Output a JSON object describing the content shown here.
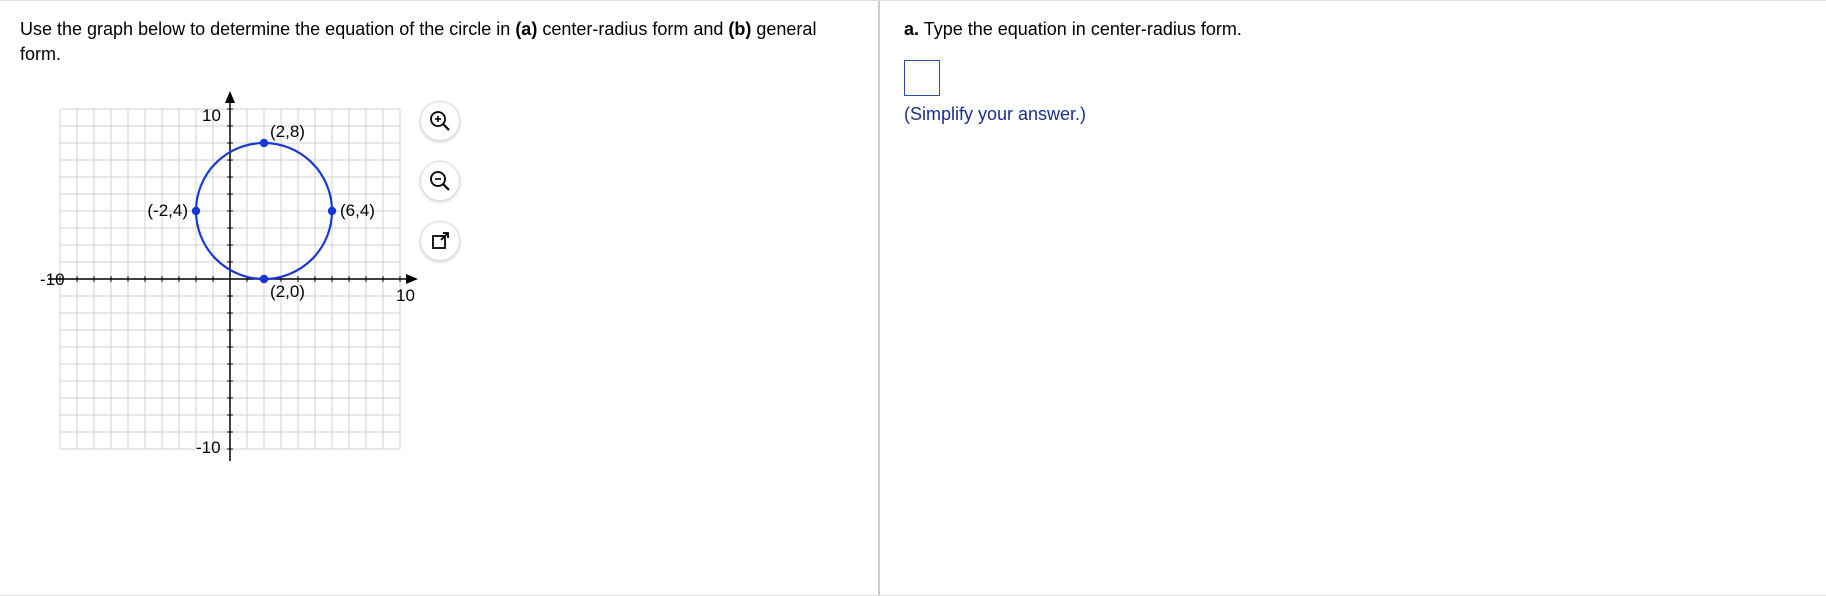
{
  "prompt": {
    "prefix": "Use the graph below to determine the equation of the circle in ",
    "part_a_label": "(a)",
    "middle": " center-radius form and ",
    "part_b_label": "(b)",
    "suffix": " general form."
  },
  "question": {
    "label": "a.",
    "text": " Type the equation in center-radius form."
  },
  "hint": "(Simplify your answer.)",
  "chart_data": {
    "type": "scatter",
    "title": "",
    "xlabel": "",
    "ylabel": "",
    "xlim": [
      -10,
      10
    ],
    "ylim": [
      -10,
      10
    ],
    "grid": true,
    "tick_labels_x": {
      "left": "-10",
      "right": "10"
    },
    "tick_labels_y": {
      "top": "10",
      "bottom": "-10"
    },
    "circle": {
      "center": [
        2,
        4
      ],
      "radius": 4
    },
    "points": [
      {
        "coords": [
          2,
          8
        ],
        "label": "(2,8)"
      },
      {
        "coords": [
          -2,
          4
        ],
        "label": "(-2,4)"
      },
      {
        "coords": [
          6,
          4
        ],
        "label": "(6,4)"
      },
      {
        "coords": [
          2,
          0
        ],
        "label": "(2,0)"
      }
    ]
  }
}
